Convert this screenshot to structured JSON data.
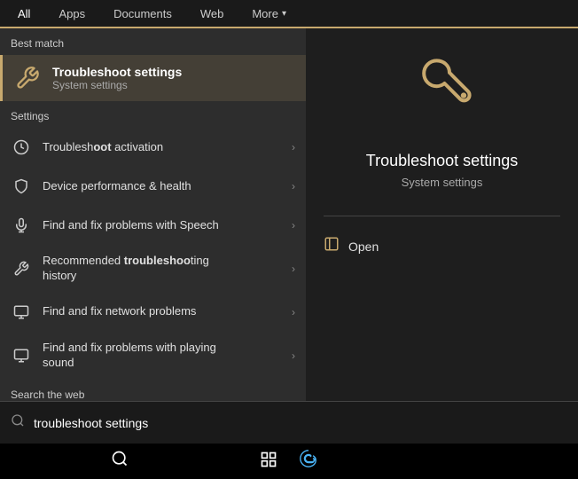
{
  "nav": {
    "tabs": [
      {
        "id": "all",
        "label": "All",
        "active": true
      },
      {
        "id": "apps",
        "label": "Apps",
        "active": false
      },
      {
        "id": "documents",
        "label": "Documents",
        "active": false
      },
      {
        "id": "web",
        "label": "Web",
        "active": false
      },
      {
        "id": "more",
        "label": "More",
        "active": false
      }
    ]
  },
  "left": {
    "best_match_label": "Best match",
    "best_match": {
      "title": "Troubleshoot settings",
      "subtitle": "System settings"
    },
    "settings_label": "Settings",
    "items": [
      {
        "id": "activation",
        "text_before": "Troublesh",
        "text_bold": "oot",
        "text_after": " activation",
        "full_text": "Troubleshoot activation",
        "icon": "⊙"
      },
      {
        "id": "device-health",
        "text_before": "",
        "text_bold": "",
        "text_after": "Device performance & health",
        "full_text": "Device performance & health",
        "icon": "🛡"
      },
      {
        "id": "speech",
        "text_before": "",
        "text_bold": "",
        "text_after": "Find and fix problems with Speech",
        "full_text": "Find and fix problems with Speech",
        "icon": "🎤"
      },
      {
        "id": "history",
        "text_before": "Recommended ",
        "text_bold": "troubleshoo",
        "text_after": "ting\nhistory",
        "full_text": "Recommended troubleshooting history",
        "icon": "🔧"
      },
      {
        "id": "network",
        "text_before": "",
        "text_bold": "",
        "text_after": "Find and fix network problems",
        "full_text": "Find and fix network problems",
        "icon": "🖥"
      },
      {
        "id": "sound",
        "text_before": "",
        "text_bold": "",
        "text_after": "Find and fix problems with playing\nsound",
        "full_text": "Find and fix problems with playing sound",
        "icon": "🖥"
      }
    ],
    "web_label": "Search the web"
  },
  "right": {
    "title": "Troubleshoot settings",
    "subtitle": "System settings",
    "actions": [
      {
        "label": "Open",
        "icon": "open"
      }
    ]
  },
  "search": {
    "value": "troubleshoot settings",
    "placeholder": "troubleshoot settings"
  },
  "taskbar": {
    "icons": [
      "search",
      "grid",
      "edge"
    ]
  }
}
